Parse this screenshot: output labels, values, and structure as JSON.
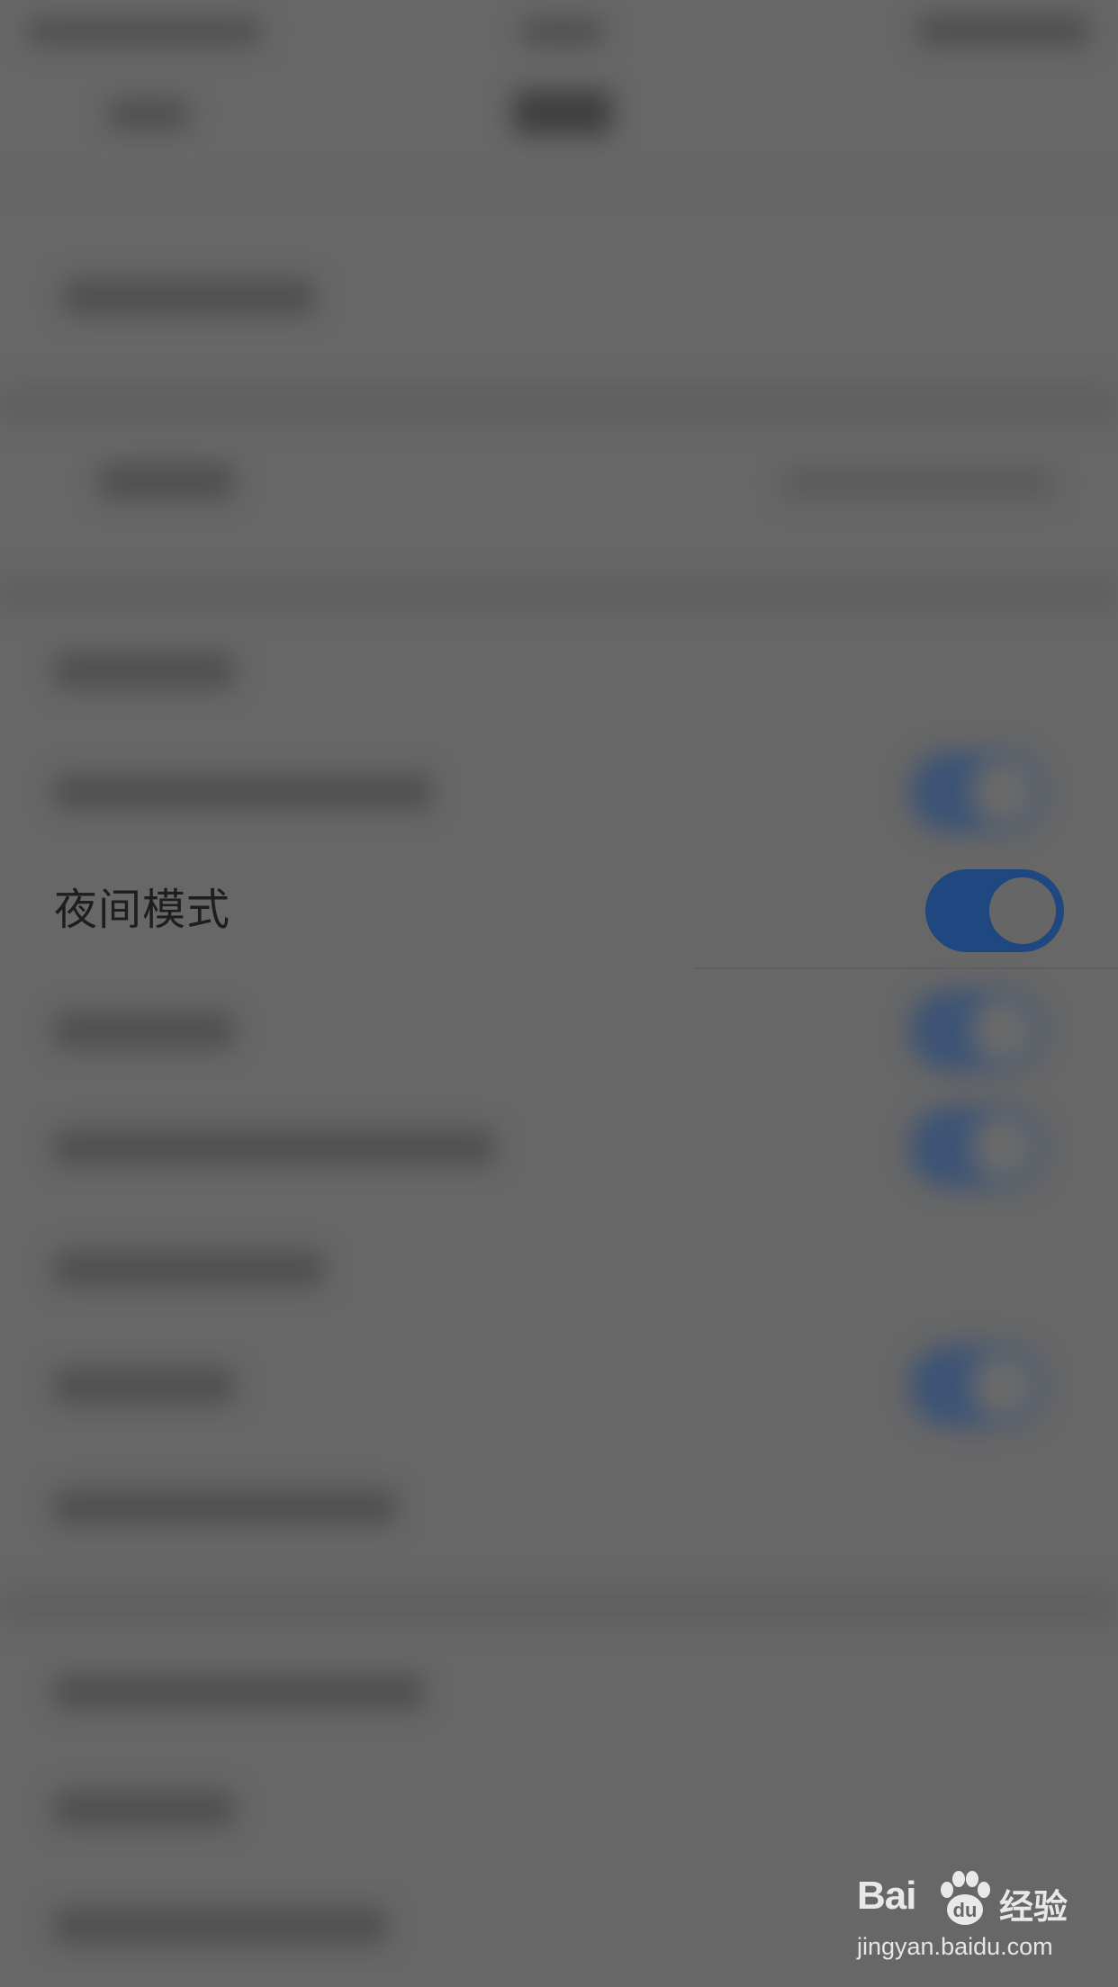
{
  "settings": {
    "night_mode": {
      "label": "夜间模式",
      "enabled": true
    }
  },
  "colors": {
    "overlay": "#676767",
    "toggle_on": "#1f4780",
    "label_text": "#1e1e1e"
  },
  "watermark": {
    "logo_text": "Bai",
    "logo_suffix": "经验",
    "url": "jingyan.baidu.com",
    "icon": "paw-icon"
  }
}
